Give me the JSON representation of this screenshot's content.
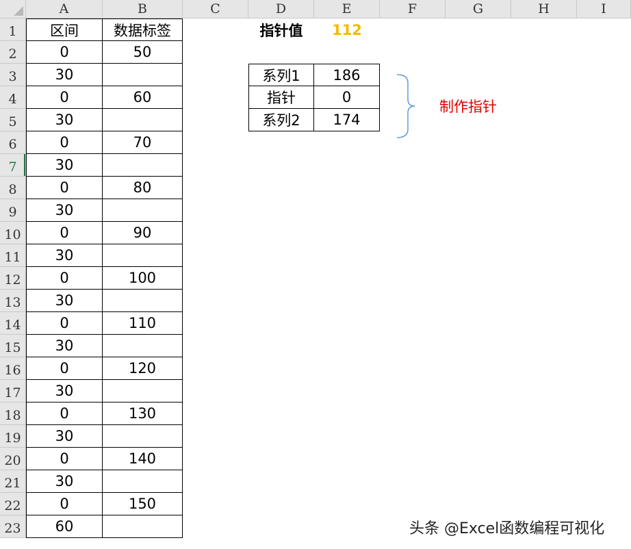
{
  "columns": [
    "A",
    "B",
    "C",
    "D",
    "E",
    "F",
    "G",
    "H",
    "I"
  ],
  "rows": [
    "1",
    "2",
    "3",
    "4",
    "5",
    "6",
    "7",
    "8",
    "9",
    "10",
    "11",
    "12",
    "13",
    "14",
    "15",
    "16",
    "17",
    "18",
    "19",
    "20",
    "21",
    "22",
    "23"
  ],
  "colA": [
    "区间",
    "0",
    "30",
    "0",
    "30",
    "0",
    "30",
    "0",
    "30",
    "0",
    "30",
    "0",
    "30",
    "0",
    "30",
    "0",
    "30",
    "0",
    "30",
    "0",
    "30",
    "0",
    "60"
  ],
  "colB": [
    "数据标签",
    "50",
    "",
    "60",
    "",
    "70",
    "",
    "80",
    "",
    "90",
    "",
    "100",
    "",
    "110",
    "",
    "120",
    "",
    "130",
    "",
    "140",
    "",
    "150",
    ""
  ],
  "pointer": {
    "label": "指针值",
    "value": "112"
  },
  "table": [
    {
      "name": "系列1",
      "value": "186"
    },
    {
      "name": "指针",
      "value": "0"
    },
    {
      "name": "系列2",
      "value": "174"
    }
  ],
  "annotation": "制作指针",
  "watermark": "头条 @Excel函数编程可视化",
  "colors": {
    "pointer_value": "#f6b900",
    "annotation": "#e00000",
    "brace": "#5b9bd5",
    "selected_header": "#217346"
  }
}
